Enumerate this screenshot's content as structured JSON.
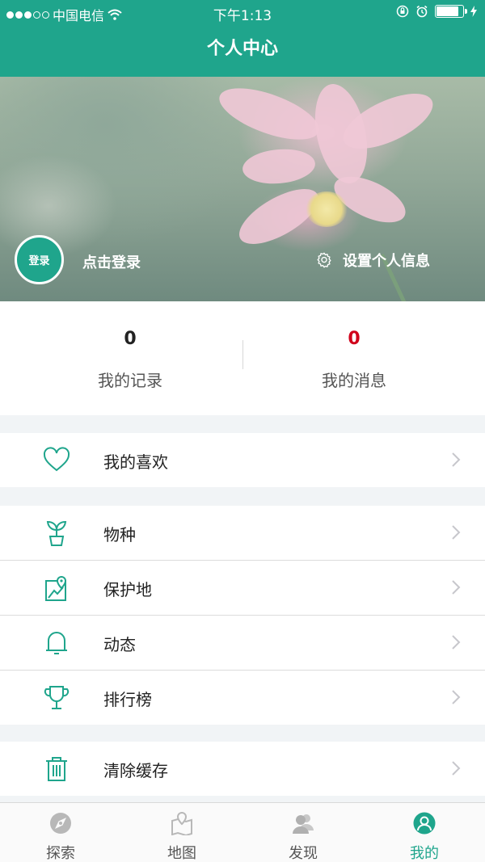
{
  "status_bar": {
    "carrier": "中国电信",
    "time": "下午1:13",
    "battery_level": 0.85
  },
  "nav": {
    "title": "个人中心"
  },
  "profile": {
    "avatar_label": "登录",
    "login_prompt": "点击登录",
    "settings_label": "设置个人信息"
  },
  "stats": [
    {
      "value": "0",
      "label": "我的记录",
      "color": "#222222"
    },
    {
      "value": "0",
      "label": "我的消息",
      "color": "#d0021b"
    }
  ],
  "menu": {
    "favorites": {
      "label": "我的喜欢",
      "icon": "heart-icon"
    },
    "species": {
      "label": "物种",
      "icon": "sprout-icon"
    },
    "reserves": {
      "label": "保护地",
      "icon": "map-pin-icon"
    },
    "activity": {
      "label": "动态",
      "icon": "bell-icon"
    },
    "ranking": {
      "label": "排行榜",
      "icon": "trophy-icon"
    },
    "clear_cache": {
      "label": "清除缓存",
      "icon": "trash-icon"
    }
  },
  "tabbar": {
    "active": "mine",
    "tabs": [
      {
        "id": "explore",
        "label": "探索",
        "icon": "compass-icon"
      },
      {
        "id": "map",
        "label": "地图",
        "icon": "map-icon"
      },
      {
        "id": "discover",
        "label": "发现",
        "icon": "people-icon"
      },
      {
        "id": "mine",
        "label": "我的",
        "icon": "person-icon"
      }
    ]
  },
  "colors": {
    "accent": "#1fa58c",
    "message_count": "#d0021b",
    "chevron": "#c7c7cc"
  }
}
